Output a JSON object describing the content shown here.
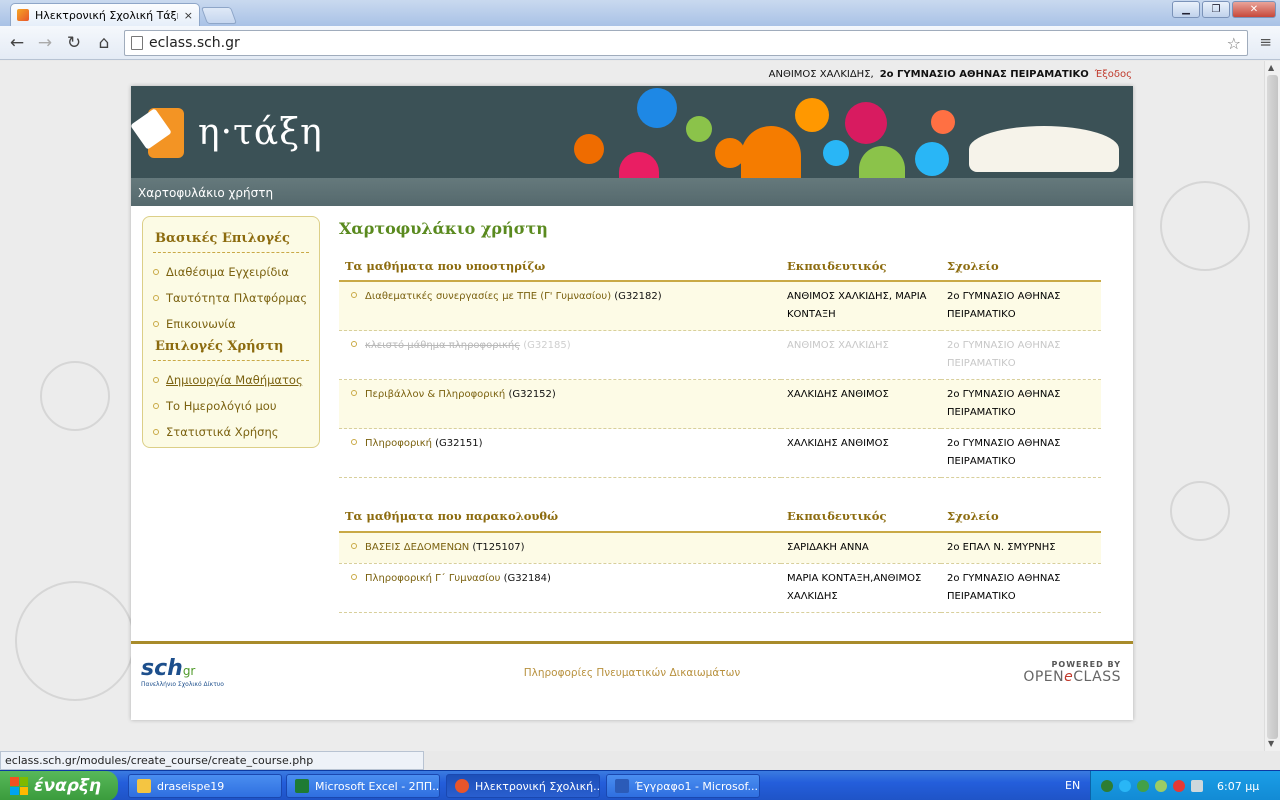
{
  "browser": {
    "tab_title": "Ηλεκτρονική Σχολική Τάξη (ι",
    "tab_close": "×",
    "url": "eclass.sch.gr",
    "status_url": "eclass.sch.gr/modules/create_course/create_course.php"
  },
  "userbar": {
    "user": "ΑΝΘΙΜΟΣ ΧΑΛΚΙΔΗΣ,",
    "school": "2ο ΓΥΜΝΑΣΙΟ ΑΘΗΝΑΣ ΠΕΙΡΑΜΑΤΙΚΟ",
    "logout": "Έξοδος"
  },
  "brand": {
    "name": "η·τάξη"
  },
  "breadcrumb": "Χαρτοφυλάκιο χρήστη",
  "sidebar": {
    "basic_heading": "Βασικές Επιλογές",
    "basic_items": [
      {
        "label": "Διαθέσιμα Εγχειρίδια"
      },
      {
        "label": "Ταυτότητα Πλατφόρμας"
      },
      {
        "label": "Επικοινωνία"
      }
    ],
    "user_heading": "Επιλογές Χρήστη",
    "user_items": [
      {
        "label": "Δημιουργία Μαθήματος"
      },
      {
        "label": "Το Ημερολόγιό μου"
      },
      {
        "label": "Στατιστικά Χρήσης"
      }
    ]
  },
  "main": {
    "title": "Χαρτοφυλάκιο χρήστη",
    "teaching": {
      "headers": [
        "Τα μαθήματα που υποστηρίζω",
        "Εκπαιδευτικός",
        "Σχολείο"
      ],
      "rows": [
        {
          "course": "Διαθεματικές συνεργασίες με ΤΠΕ (Γ' Γυμνασίου)",
          "code": "(G32182)",
          "teacher": "ΑΝΘΙΜΟΣ ΧΑΛΚΙΔΗΣ, ΜΑΡΙΑ ΚΟΝΤΑΞΗ",
          "school": "2ο ΓΥΜΝΑΣΙΟ ΑΘΗΝΑΣ ΠΕΙΡΑΜΑΤΙΚΟ"
        },
        {
          "course": "κλειστό μάθημα πληροφορικής",
          "code": "(G32185)",
          "teacher": "ΑΝΘΙΜΟΣ ΧΑΛΚΙΔΗΣ",
          "school": "2ο ΓΥΜΝΑΣΙΟ ΑΘΗΝΑΣ ΠΕΙΡΑΜΑΤΙΚΟ"
        },
        {
          "course": "Περιβάλλον & Πληροφορική",
          "code": "(G32152)",
          "teacher": "ΧΑΛΚΙΔΗΣ ΑΝΘΙΜΟΣ",
          "school": "2ο ΓΥΜΝΑΣΙΟ ΑΘΗΝΑΣ ΠΕΙΡΑΜΑΤΙΚΟ"
        },
        {
          "course": "Πληροφορική",
          "code": "(G32151)",
          "teacher": "ΧΑΛΚΙΔΗΣ ΑΝΘΙΜΟΣ",
          "school": "2ο ΓΥΜΝΑΣΙΟ ΑΘΗΝΑΣ ΠΕΙΡΑΜΑΤΙΚΟ"
        }
      ]
    },
    "attending": {
      "headers": [
        "Τα μαθήματα που παρακολουθώ",
        "Εκπαιδευτικός",
        "Σχολείο"
      ],
      "rows": [
        {
          "course": "ΒΑΣΕΙΣ ΔΕΔΟΜΕΝΩΝ",
          "code": "(T125107)",
          "teacher": "ΣΑΡΙΔΑΚΗ ΑΝΝΑ",
          "school": "2ο ΕΠΑΛ Ν. ΣΜΥΡΝΗΣ"
        },
        {
          "course": "Πληροφορική Γ΄ Γυμνασίου",
          "code": "(G32184)",
          "teacher": "ΜΑΡΙΑ ΚΟΝΤΑΞΗ,ΑΝΘΙΜΟΣ ΧΑΛΚΙΔΗΣ",
          "school": "2ο ΓΥΜΝΑΣΙΟ ΑΘΗΝΑΣ ΠΕΙΡΑΜΑΤΙΚΟ"
        }
      ]
    }
  },
  "footer": {
    "copyright": "Πληροφορίες Πνευματικών Δικαιωμάτων",
    "sch_logo": "sch",
    "sch_logo_gr": "gr",
    "sch_sub": "Πανελλήνιο Σχολικό Δίκτυο",
    "powered": "POWERED BY",
    "open": "OPEN",
    "e": "e",
    "class": "CLASS"
  },
  "taskbar": {
    "start": "έναρξη",
    "items": [
      {
        "label": "draseispe19",
        "icon_color": "#f4c542"
      },
      {
        "label": "Microsoft Excel - 2ΠΠ...",
        "icon_color": "#1e7b34"
      },
      {
        "label": "Ηλεκτρονική Σχολική...",
        "icon_color": "#e8552b"
      },
      {
        "label": "Έγγραφο1 - Microsof...",
        "icon_color": "#2b5bb8"
      }
    ],
    "lang": "EN",
    "clock": "6:07 μμ"
  }
}
